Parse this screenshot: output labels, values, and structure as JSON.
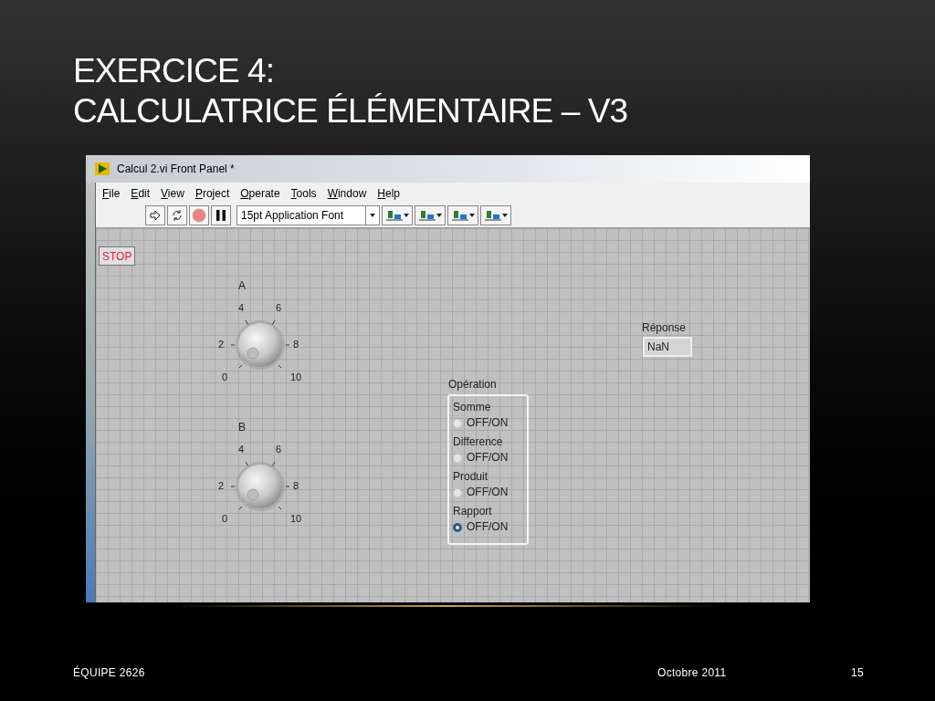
{
  "slide": {
    "title_lines": [
      "EXERCICE 4:",
      "CALCULATRICE ÉLÉMENTAIRE – V3"
    ],
    "footer": {
      "left": "ÉQUIPE 2626",
      "date": "Octobre 2011",
      "page": "15"
    }
  },
  "window": {
    "title": "Calcul 2.vi Front Panel *",
    "menu": [
      "File",
      "Edit",
      "View",
      "Project",
      "Operate",
      "Tools",
      "Window",
      "Help"
    ],
    "font_selector": "15pt Application Font"
  },
  "front_panel": {
    "stop_button": "STOP",
    "knobs": [
      {
        "label": "A",
        "scale": [
          "4",
          "6",
          "2",
          "8",
          "0",
          "10"
        ]
      },
      {
        "label": "B",
        "scale": [
          "4",
          "6",
          "2",
          "8",
          "0",
          "10"
        ]
      }
    ],
    "operation": {
      "label": "Opération",
      "options": [
        {
          "name": "Somme",
          "radio_label": "OFF/ON",
          "selected": false
        },
        {
          "name": "Difference",
          "radio_label": "OFF/ON",
          "selected": false
        },
        {
          "name": "Produit",
          "radio_label": "OFF/ON",
          "selected": false
        },
        {
          "name": "Rapport",
          "radio_label": "OFF/ON",
          "selected": true
        }
      ]
    },
    "response": {
      "label": "Réponse",
      "value": "NaN"
    }
  }
}
